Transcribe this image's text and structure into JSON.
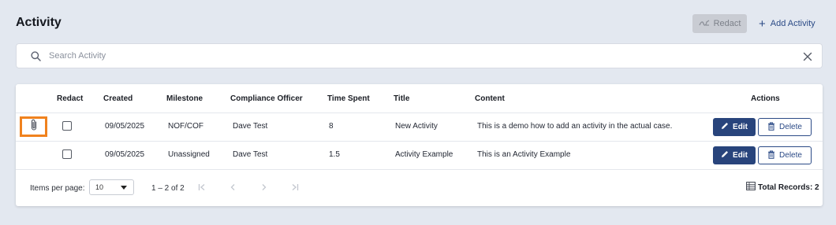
{
  "header": {
    "title": "Activity",
    "redact_label": "Redact",
    "add_activity_label": "Add Activity"
  },
  "search": {
    "placeholder": "Search Activity",
    "value": ""
  },
  "table": {
    "columns": [
      "Redact",
      "Created",
      "Milestone",
      "Compliance Officer",
      "Time Spent",
      "Title",
      "Content",
      "Actions"
    ],
    "rows": [
      {
        "has_attachment": true,
        "redact_checked": false,
        "created": "09/05/2025",
        "milestone": "NOF/COF",
        "compliance_officer": "Dave Test",
        "time_spent": "8",
        "title": "New Activity",
        "content": "This is a demo how to add an activity in the actual case."
      },
      {
        "has_attachment": false,
        "redact_checked": false,
        "created": "09/05/2025",
        "milestone": "Unassigned",
        "compliance_officer": "Dave Test",
        "time_spent": "1.5",
        "title": "Activity Example",
        "content": "This is an Activity Example"
      }
    ],
    "edit_label": "Edit",
    "delete_label": "Delete"
  },
  "pagination": {
    "items_per_page_label": "Items per page:",
    "items_per_page_value": "10",
    "range_text": "1 – 2 of 2",
    "total_records": "Total Records: 2"
  },
  "colors": {
    "primary": "#28447c",
    "highlight": "#f0821e",
    "background": "#e3e8f0"
  }
}
